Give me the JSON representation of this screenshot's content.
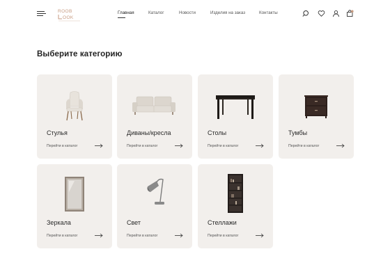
{
  "header": {
    "logo_text": "ROOB LOOK",
    "nav": [
      {
        "label": "Главная",
        "active": true
      },
      {
        "label": "Каталог",
        "active": false
      },
      {
        "label": "Новости",
        "active": false
      },
      {
        "label": "Изделия на заказ",
        "active": false
      },
      {
        "label": "Контакты",
        "active": false
      }
    ],
    "icons": [
      "search-icon",
      "heart-icon",
      "user-icon",
      "cart-icon"
    ]
  },
  "page": {
    "title": "Выберите категорию"
  },
  "categories": [
    {
      "name": "Стулья",
      "link": "Перейти в каталог",
      "icon": "chair-icon"
    },
    {
      "name": "Диваны/кресла",
      "link": "Перейти в каталог",
      "icon": "sofa-icon"
    },
    {
      "name": "Столы",
      "link": "Перейти в каталог",
      "icon": "table-icon"
    },
    {
      "name": "Тумбы",
      "link": "Перейти в каталог",
      "icon": "nightstand-icon"
    },
    {
      "name": "Зеркала",
      "link": "Перейти в каталог",
      "icon": "mirror-icon"
    },
    {
      "name": "Свет",
      "link": "Перейти в каталог",
      "icon": "lamp-icon"
    },
    {
      "name": "Стеллажи",
      "link": "Перейти в каталог",
      "icon": "bookshelf-icon"
    }
  ],
  "colors": {
    "card_bg": "#f2efec",
    "logo_accent": "#c79a80",
    "text": "#2a2a2a"
  }
}
